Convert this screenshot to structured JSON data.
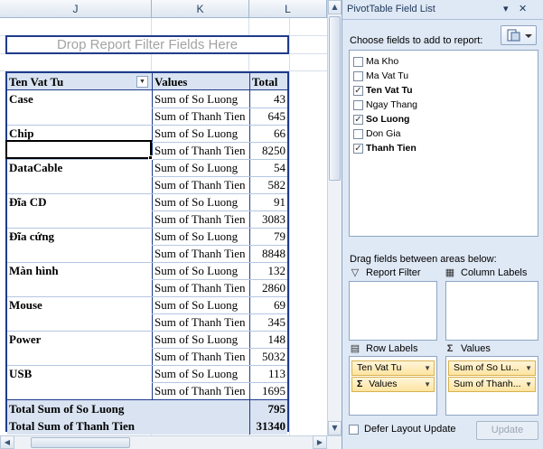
{
  "sheet": {
    "columns": [
      "J",
      "K",
      "L"
    ],
    "drop_filter_text": "Drop Report Filter Fields Here",
    "pivot": {
      "headers": {
        "name": "Ten Vat Tu",
        "values": "Values",
        "total": "Total"
      },
      "rows": [
        {
          "name": "Case",
          "values": "Sum of So Luong",
          "total": "43"
        },
        {
          "name": "",
          "values": "Sum of Thanh Tien",
          "total": "645"
        },
        {
          "name": "Chip",
          "values": "Sum of So Luong",
          "total": "66"
        },
        {
          "name": "",
          "values": "Sum of Thanh Tien",
          "total": "8250"
        },
        {
          "name": "DataCable",
          "values": "Sum of So Luong",
          "total": "54"
        },
        {
          "name": "",
          "values": "Sum of Thanh Tien",
          "total": "582"
        },
        {
          "name": "Đĩa CD",
          "values": "Sum of So Luong",
          "total": "91"
        },
        {
          "name": "",
          "values": "Sum of Thanh Tien",
          "total": "3083"
        },
        {
          "name": "Đĩa cứng",
          "values": "Sum of So Luong",
          "total": "79"
        },
        {
          "name": "",
          "values": "Sum of Thanh Tien",
          "total": "8848"
        },
        {
          "name": "Màn hình",
          "values": "Sum of So Luong",
          "total": "132"
        },
        {
          "name": "",
          "values": "Sum of Thanh Tien",
          "total": "2860"
        },
        {
          "name": "Mouse",
          "values": "Sum of So Luong",
          "total": "69"
        },
        {
          "name": "",
          "values": "Sum of Thanh Tien",
          "total": "345"
        },
        {
          "name": "Power",
          "values": "Sum of So Luong",
          "total": "148"
        },
        {
          "name": "",
          "values": "Sum of Thanh Tien",
          "total": "5032"
        },
        {
          "name": "USB",
          "values": "Sum of So Luong",
          "total": "113"
        },
        {
          "name": "",
          "values": "Sum of Thanh Tien",
          "total": "1695"
        }
      ],
      "grand_totals": [
        {
          "label": "Total Sum of So Luong",
          "total": "795"
        },
        {
          "label": "Total Sum of Thanh Tien",
          "total": "31340"
        }
      ]
    }
  },
  "panel": {
    "title": "PivotTable Field List",
    "choose_label": "Choose fields to add to report:",
    "fields": [
      {
        "label": "Ma Kho",
        "checked": false
      },
      {
        "label": "Ma Vat Tu",
        "checked": false
      },
      {
        "label": "Ten Vat Tu",
        "checked": true
      },
      {
        "label": "Ngay Thang",
        "checked": false
      },
      {
        "label": "So Luong",
        "checked": true
      },
      {
        "label": "Don Gia",
        "checked": false
      },
      {
        "label": "Thanh Tien",
        "checked": true
      }
    ],
    "drag_label": "Drag fields between areas below:",
    "areas": {
      "report_filter": "Report Filter",
      "column_labels": "Column Labels",
      "row_labels": "Row Labels",
      "values": "Values"
    },
    "row_pills": [
      "Ten Vat Tu",
      "Values"
    ],
    "value_pills": [
      "Sum of So Lu...",
      "Sum of Thanh..."
    ],
    "defer_label": "Defer Layout Update",
    "update_label": "Update"
  },
  "icons": {
    "close": "close-icon",
    "dropdown": "dropdown-arrow-icon",
    "filter": "filter-icon",
    "column": "column-labels-icon",
    "rows": "row-labels-icon",
    "sigma": "sigma-icon"
  }
}
